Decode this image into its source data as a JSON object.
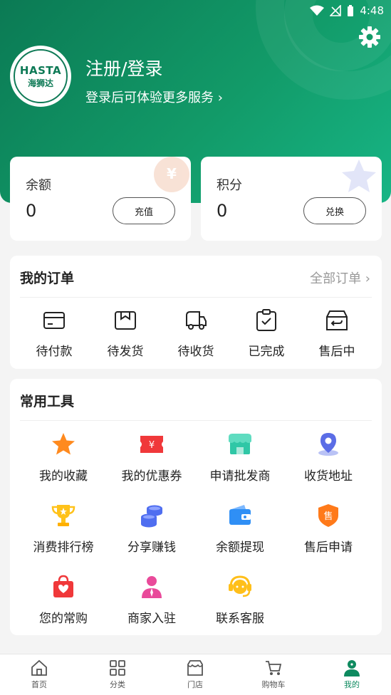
{
  "status": {
    "time": "4:48"
  },
  "header": {
    "logo_text": "HASTA",
    "logo_sub": "海狮达",
    "login_title": "注册/登录",
    "login_sub": "登录后可体验更多服务 ›"
  },
  "balance": {
    "label": "余额",
    "value": "0",
    "button": "充值"
  },
  "points": {
    "label": "积分",
    "value": "0",
    "button": "兑换"
  },
  "orders": {
    "title": "我的订单",
    "all_link": "全部订单 ›",
    "items": [
      {
        "label": "待付款",
        "icon": "wallet-card-icon"
      },
      {
        "label": "待发货",
        "icon": "package-box-icon"
      },
      {
        "label": "待收货",
        "icon": "delivery-truck-icon"
      },
      {
        "label": "已完成",
        "icon": "clipboard-check-icon"
      },
      {
        "label": "售后中",
        "icon": "return-box-icon"
      }
    ]
  },
  "tools": {
    "title": "常用工具",
    "items": [
      {
        "label": "我的收藏",
        "icon": "star-icon",
        "color": "#ff8a1e"
      },
      {
        "label": "我的优惠券",
        "icon": "coupon-icon",
        "color": "#f0383a"
      },
      {
        "label": "申请批发商",
        "icon": "shop-icon",
        "color": "#2fc7a6"
      },
      {
        "label": "收货地址",
        "icon": "location-pin-icon",
        "color": "#5b6de6"
      },
      {
        "label": "消费排行榜",
        "icon": "trophy-icon",
        "color": "#ffc21a"
      },
      {
        "label": "分享赚钱",
        "icon": "coins-stack-icon",
        "color": "#4f6ef0"
      },
      {
        "label": "余额提现",
        "icon": "wallet-icon",
        "color": "#2f8ff5"
      },
      {
        "label": "售后申请",
        "icon": "shield-badge-icon",
        "color": "#ff7a1a"
      },
      {
        "label": "您的常购",
        "icon": "shopping-bag-icon",
        "color": "#f0383a"
      },
      {
        "label": "商家入驻",
        "icon": "merchant-person-icon",
        "color": "#e94a9a"
      },
      {
        "label": "联系客服",
        "icon": "customer-service-icon",
        "color": "#ffbf1a"
      }
    ]
  },
  "tabbar": {
    "items": [
      {
        "label": "首页",
        "icon": "home-icon"
      },
      {
        "label": "分类",
        "icon": "grid-icon"
      },
      {
        "label": "门店",
        "icon": "store-icon"
      },
      {
        "label": "购物车",
        "icon": "cart-icon"
      },
      {
        "label": "我的",
        "icon": "person-icon",
        "active": true
      }
    ],
    "active_color": "#0e8a5f"
  }
}
